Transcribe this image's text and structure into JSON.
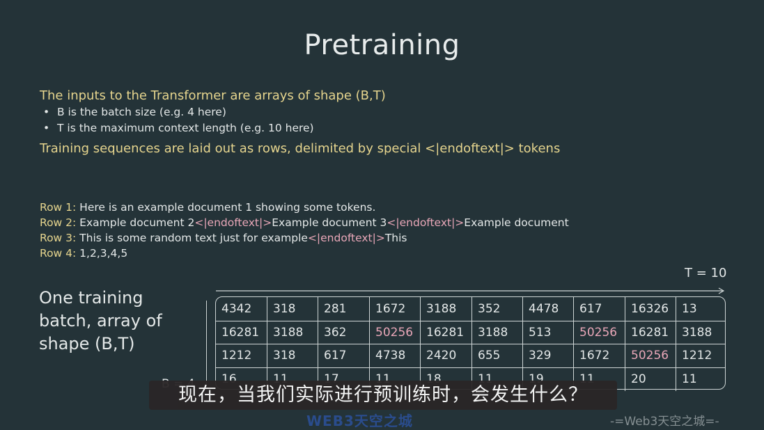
{
  "slide": {
    "title": "Pretraining",
    "heading1": "The inputs to the Transformer are arrays of shape (B,T)",
    "bullets": [
      "B is the batch size (e.g. 4 here)",
      "T is the maximum context length (e.g. 10 here)"
    ],
    "heading2": "Training sequences are laid out as rows, delimited by special <|endoftext|> tokens",
    "rows": {
      "r1": {
        "label": "Row 1:",
        "text": " Here is an example document 1 showing some tokens."
      },
      "r2": {
        "label": "Row 2:",
        "a": " Example document 2",
        "tok": "<|endoftext|>",
        "b": "Example document 3",
        "tok2": "<|endoftext|>",
        "c": "Example document"
      },
      "r3": {
        "label": "Row 3:",
        "a": " This is some random text just for example",
        "tok": "<|endoftext|>",
        "b": "This"
      },
      "r4": {
        "label": "Row 4:",
        "text": " 1,2,3,4,5"
      }
    },
    "t_label": "T = 10",
    "batch_label": "One training batch, array of shape (B,T)",
    "b_label": "B = 4",
    "grid": [
      [
        "4342",
        "318",
        "281",
        "1672",
        "3188",
        "352",
        "4478",
        "617",
        "16326",
        "13"
      ],
      [
        "16281",
        "3188",
        "362",
        "50256",
        "16281",
        "3188",
        "513",
        "50256",
        "16281",
        "3188"
      ],
      [
        "1212",
        "318",
        "617",
        "4738",
        "2420",
        "655",
        "329",
        "1672",
        "50256",
        "1212"
      ],
      [
        "16",
        "11",
        "17",
        "11",
        "18",
        "11",
        "19",
        "11",
        "20",
        "11"
      ]
    ],
    "highlight_token": "50256",
    "colors": {
      "background": "#243338",
      "heading": "#e6d58e",
      "token": "#e9a7b8",
      "text": "#e4e8e8"
    }
  },
  "overlay": {
    "subtitle": "现在，当我们实际进行预训练时，会发生什么？",
    "watermark_left": "WEB3天空之城",
    "watermark_right": "-=Web3天空之城=-"
  }
}
